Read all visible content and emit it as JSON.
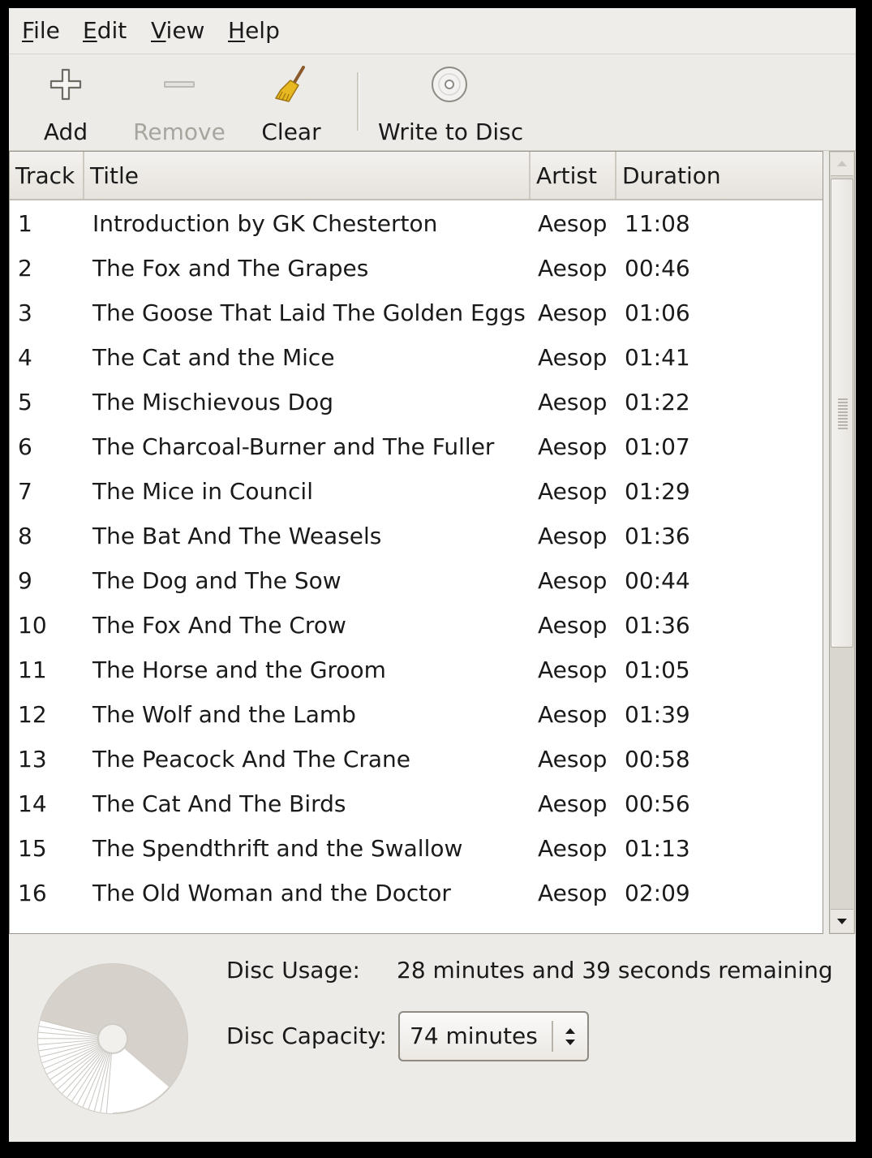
{
  "menu": {
    "file": "File",
    "edit": "Edit",
    "view": "View",
    "help": "Help",
    "file_mn": "F",
    "file_rest": "ile",
    "edit_mn": "E",
    "edit_rest": "dit",
    "view_mn": "V",
    "view_rest": "iew",
    "help_mn": "H",
    "help_rest": "elp"
  },
  "toolbar": {
    "add_label": "Add",
    "add_icon": "plus-icon",
    "remove_label": "Remove",
    "remove_icon": "minus-icon",
    "remove_disabled": true,
    "clear_label": "Clear",
    "clear_icon": "broom-icon",
    "write_label": "Write to Disc",
    "write_icon": "disc-icon"
  },
  "table": {
    "columns": [
      "Track",
      "Title",
      "Artist",
      "Duration"
    ],
    "rows": [
      [
        "1",
        "Introduction by GK Chesterton",
        "Aesop",
        "11:08"
      ],
      [
        "2",
        "The Fox and The Grapes",
        "Aesop",
        "00:46"
      ],
      [
        "3",
        "The Goose That Laid The Golden Eggs",
        "Aesop",
        "01:06"
      ],
      [
        "4",
        "The Cat and the Mice",
        "Aesop",
        "01:41"
      ],
      [
        "5",
        "The Mischievous Dog",
        "Aesop",
        "01:22"
      ],
      [
        "6",
        "The Charcoal-Burner and The Fuller",
        "Aesop",
        "01:07"
      ],
      [
        "7",
        "The Mice in Council",
        "Aesop",
        "01:29"
      ],
      [
        "8",
        "The Bat And The Weasels",
        "Aesop",
        "01:36"
      ],
      [
        "9",
        "The Dog and The Sow",
        "Aesop",
        "00:44"
      ],
      [
        "10",
        "The Fox And The Crow",
        "Aesop",
        "01:36"
      ],
      [
        "11",
        "The Horse and the Groom",
        "Aesop",
        "01:05"
      ],
      [
        "12",
        "The Wolf and the Lamb",
        "Aesop",
        "01:39"
      ],
      [
        "13",
        "The Peacock And The Crane",
        "Aesop",
        "00:58"
      ],
      [
        "14",
        "The Cat And The Birds",
        "Aesop",
        "00:56"
      ],
      [
        "15",
        "The Spendthrift and the Swallow",
        "Aesop",
        "01:13"
      ],
      [
        "16",
        "The Old Woman and the Doctor",
        "Aesop",
        "02:09"
      ]
    ]
  },
  "disc": {
    "usage_label": "Disc Usage:",
    "usage_value": "28 minutes and 39 seconds remaining",
    "capacity_label": "Disc Capacity:",
    "capacity_value": "74 minutes",
    "used_fraction": 0.613
  },
  "colors": {
    "window_bg": "#edebe7",
    "disabled_text": "#a8a59f",
    "broom_yellow": "#e8b820"
  }
}
